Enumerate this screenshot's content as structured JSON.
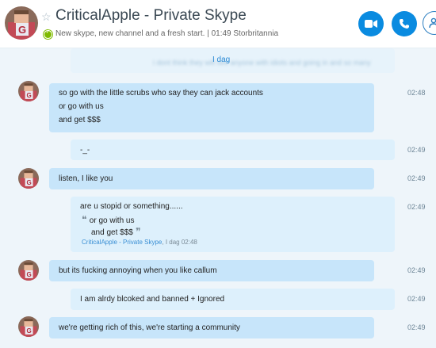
{
  "header": {
    "title": "CriticalApple - Private Skype",
    "mood": "New skype, new channel and a fresh start. | 01:49 Storbritannia",
    "avatar_letter": "G"
  },
  "chat": {
    "faded_preview": "i dont think they will see anyone with idiots and going in and so many",
    "prev_message": "I dag",
    "messages": [
      {
        "lines": [
          "so go with the little scrubs who say they can jack accounts",
          "or go with us",
          "and get $$$"
        ],
        "time": "02:48"
      },
      {
        "lines": [
          "-_-"
        ],
        "time": "02:49"
      },
      {
        "lines": [
          "listen, I like you"
        ],
        "time": "02:49"
      },
      {
        "lines": [
          "are u stopid or something......"
        ],
        "quote": {
          "line1": "or go with us",
          "line2": "and get $$$",
          "source": "CriticalApple - Private Skype",
          "date": ", I dag 02:48"
        },
        "time": "02:49"
      },
      {
        "lines": [
          "but its fucking annoying when you like callum"
        ],
        "time": "02:49"
      },
      {
        "lines": [
          "I am alrdy blcoked and banned + Ignored"
        ],
        "time": "02:49"
      },
      {
        "lines": [
          "we're getting rich of this, we're starting a community"
        ],
        "time": "02:49"
      }
    ]
  }
}
